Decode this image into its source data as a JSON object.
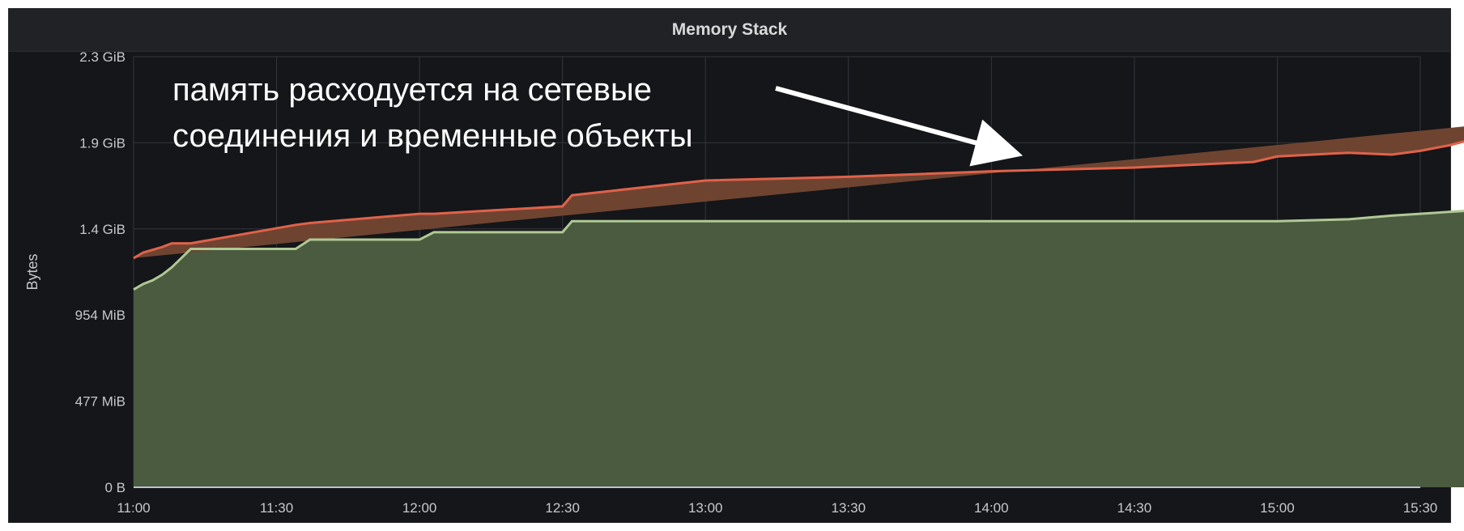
{
  "panel": {
    "title": "Memory Stack"
  },
  "chart_data": {
    "type": "area",
    "stacked": true,
    "title": "Memory Stack",
    "ylabel": "Bytes",
    "xlabel": "",
    "ylim_gib": [
      0,
      2.33
    ],
    "y_ticks": [
      {
        "label": "0 B",
        "value_gib": 0
      },
      {
        "label": "477 MiB",
        "value_gib": 0.466
      },
      {
        "label": "954 MiB",
        "value_gib": 0.932
      },
      {
        "label": "1.4 GiB",
        "value_gib": 1.398
      },
      {
        "label": "1.9 GiB",
        "value_gib": 1.864
      },
      {
        "label": "2.3 GiB",
        "value_gib": 2.33
      }
    ],
    "x_ticks": [
      "11:00",
      "11:30",
      "12:00",
      "12:30",
      "13:00",
      "13:30",
      "14:00",
      "14:30",
      "15:00",
      "15:30"
    ],
    "grid": true,
    "x_unit": "minutes since 11:00 (tick labels shown as clock time)",
    "series": [
      {
        "color": "#b0c995",
        "fill": "#4b5b40",
        "points": [
          [
            0,
            1.07
          ],
          [
            2,
            1.1
          ],
          [
            4,
            1.12
          ],
          [
            6,
            1.15
          ],
          [
            8,
            1.19
          ],
          [
            12,
            1.29
          ],
          [
            34,
            1.29
          ],
          [
            37,
            1.34
          ],
          [
            60,
            1.34
          ],
          [
            63,
            1.38
          ],
          [
            90,
            1.38
          ],
          [
            92,
            1.44
          ],
          [
            240,
            1.44
          ],
          [
            235,
            1.44
          ],
          [
            240,
            1.44
          ],
          [
            255,
            1.45
          ],
          [
            264,
            1.47
          ],
          [
            270,
            1.48
          ],
          [
            276,
            1.49
          ],
          [
            282,
            1.5
          ],
          [
            286,
            1.53
          ],
          [
            290,
            1.57
          ],
          [
            294,
            1.62
          ],
          [
            298,
            1.66
          ],
          [
            302,
            1.68
          ],
          [
            304,
            1.68
          ]
        ]
      },
      {
        "color": "#e0624a",
        "fill": "#6e4431",
        "points": [
          [
            0,
            0.17
          ],
          [
            2,
            0.17
          ],
          [
            6,
            0.18
          ],
          [
            8,
            0.17
          ],
          [
            12,
            0.13
          ],
          [
            34,
            0.13
          ],
          [
            37,
            0.14
          ],
          [
            60,
            0.14
          ],
          [
            63,
            0.14
          ],
          [
            90,
            0.14
          ],
          [
            92,
            0.2
          ],
          [
            120,
            0.22
          ],
          [
            150,
            0.24
          ],
          [
            180,
            0.27
          ],
          [
            210,
            0.29
          ],
          [
            235,
            0.31
          ],
          [
            240,
            0.32
          ],
          [
            255,
            0.33
          ],
          [
            264,
            0.31
          ],
          [
            270,
            0.32
          ],
          [
            276,
            0.32
          ],
          [
            282,
            0.32
          ],
          [
            286,
            0.32
          ],
          [
            290,
            0.31
          ],
          [
            294,
            0.3
          ],
          [
            298,
            0.32
          ],
          [
            302,
            0.33
          ],
          [
            304,
            0.33
          ]
        ]
      }
    ],
    "annotation": {
      "lines": [
        "память расходуется на сетевые",
        "соединения и временные объекты"
      ],
      "color": "#ffffff"
    }
  }
}
